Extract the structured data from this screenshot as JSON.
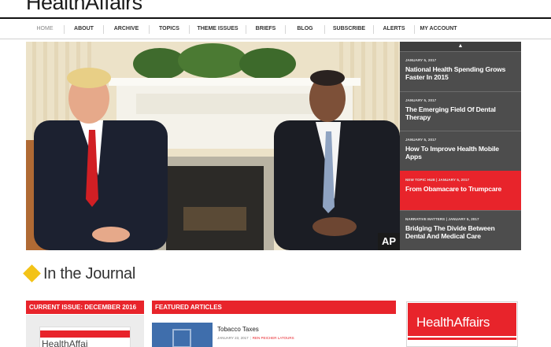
{
  "header": {
    "logo": "HealthAffairs"
  },
  "nav": {
    "items": [
      {
        "label": "HOME",
        "width": 48
      },
      {
        "label": "ABOUT",
        "width": 49
      },
      {
        "label": "ARCHIVE",
        "width": 57
      },
      {
        "label": "TOPICS",
        "width": 50
      },
      {
        "label": "THEME ISSUES",
        "width": 71
      },
      {
        "label": "BRIEFS",
        "width": 49
      },
      {
        "label": "BLOG",
        "width": 49
      },
      {
        "label": "SUBSCRIBE",
        "width": 61
      },
      {
        "label": "ALERTS",
        "width": 51
      },
      {
        "label": "MY ACCOUNT",
        "width": 60
      }
    ]
  },
  "hero": {
    "credit": "AP"
  },
  "stories": {
    "up_arrow": "▲",
    "items": [
      {
        "date": "JANUARY 5, 2017",
        "title": "National Health Spending Grows Faster In 2015",
        "active": false
      },
      {
        "date": "JANUARY 5, 2017",
        "title": "The Emerging Field Of Dental Therapy",
        "active": false
      },
      {
        "date": "JANUARY 5, 2017",
        "title": "How To Improve Health Mobile Apps",
        "active": false
      },
      {
        "date": "NEW TOPIC HUB | JANUARY 5, 2017",
        "title": "From Obamacare to Trumpcare",
        "active": true
      },
      {
        "date": "NARRATIVE MATTERS | JANUARY 5, 2017",
        "title": "Bridging The Divide Between Dental And Medical Care",
        "active": false
      }
    ]
  },
  "journal": {
    "title": "In the Journal",
    "icon": "diamond-cluster-icon"
  },
  "current_issue": {
    "label": "CURRENT ISSUE: DECEMBER 2016",
    "cover_logo": "HealthAffai"
  },
  "featured": {
    "label": "FEATURED ARTICLES",
    "article": {
      "title": "Tobacco Taxes",
      "date": "JANUARY 23, 2017",
      "author": "REN PEICHER LATOURS"
    }
  },
  "promo": {
    "logo": "HealthAffairs"
  },
  "colors": {
    "accent": "#e8242b",
    "sidebar": "#4d4d4d",
    "diamond": "#f3c317"
  }
}
